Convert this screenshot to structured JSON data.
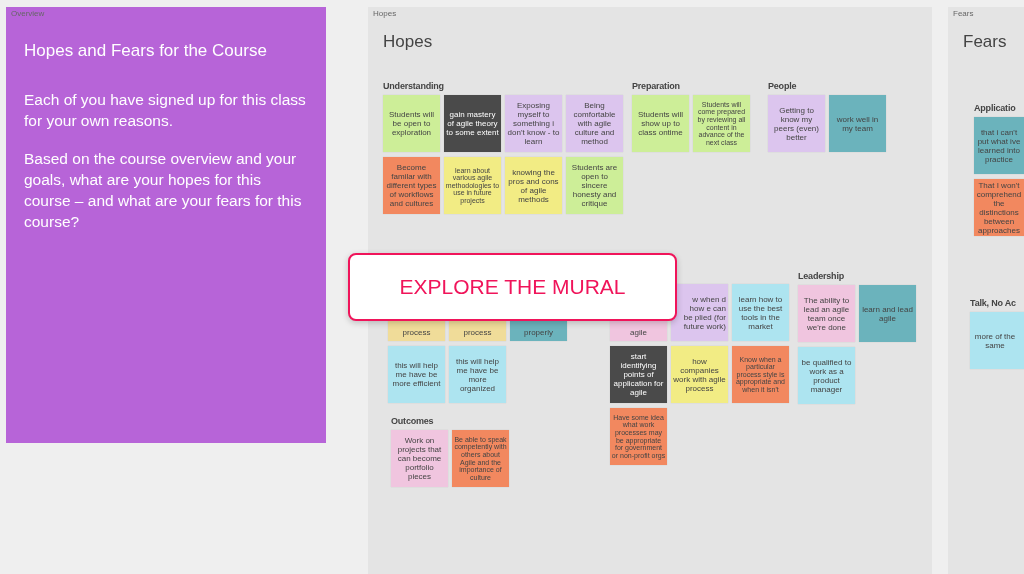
{
  "frames": [
    {
      "kind": "text-card",
      "label": "Overview",
      "title": "Hopes and Fears for the Course",
      "paragraphs": [
        "Each of you have signed up for this class for your own reasons.",
        "Based on the course overview and your goals, what are your hopes for this course – and what are your fears for this course?"
      ]
    },
    {
      "kind": "board",
      "label": "Hopes",
      "title": "Hopes",
      "groups": [
        {
          "title": "Understanding",
          "rows": [
            [
              {
                "text": "Students will be open to exploration",
                "color": "#cdee98"
              },
              {
                "text": "gain mastery of agile theory to some extent",
                "color": "#4a4a4a"
              },
              {
                "text": "Exposing myself to something i don't know - to learn",
                "color": "#dcc5ee"
              },
              {
                "text": "Being comfortable with agile culture and method",
                "color": "#dcc5ee"
              }
            ],
            [
              {
                "text": "Become familar with different types of workflows and cultures",
                "color": "#f2885f"
              },
              {
                "text": "learn about various agile methodologies to use in future projects",
                "color": "#f2ec84"
              },
              {
                "text": "knowing the pros and cons of agile methods",
                "color": "#f2ec84"
              },
              {
                "text": "Students are open to sincere honesty and critique",
                "color": "#cdee98"
              }
            ]
          ]
        },
        {
          "title": "Preparation",
          "rows": [
            [
              {
                "text": "Students will show up to class ontime",
                "color": "#cdee98"
              },
              {
                "text": "Students will come prepared by reviewing all content in advance of the next class",
                "color": "#cdee98"
              }
            ]
          ]
        },
        {
          "title": "People",
          "rows": [
            [
              {
                "text": "Getting to know my peers (even) better",
                "color": "#dcc5ee"
              },
              {
                "text": "work well in my team",
                "color": "#6bb3bc"
              }
            ]
          ]
        },
        {
          "rows": [
            [
              {
                "text": "process",
                "color": "#f0dc99",
                "kind": "partial-top"
              },
              {
                "text": "process",
                "color": "#f0dc99",
                "kind": "partial-top"
              },
              {
                "text": "properly",
                "color": "#6bb3bc",
                "kind": "partial-top"
              }
            ],
            [
              {
                "text": "this will help me have be more efficient",
                "color": "#ade4f0"
              },
              {
                "text": "this will help me have be more organized",
                "color": "#ade4f0"
              }
            ]
          ]
        },
        {
          "rows": [
            [
              {
                "text": "agile",
                "color": "#f0c5df",
                "kind": "partial-top"
              },
              {
                "text": "w when d how e can be plied (for future work)",
                "color": "#dcc5ee",
                "kind": "partial-left"
              },
              {
                "text": "learn how to use the best tools in the market",
                "color": "#ade4f0"
              }
            ],
            [
              {
                "text": "start identifying points of application for agile",
                "color": "#4a4a4a"
              },
              {
                "text": "how companies work with agile process",
                "color": "#f2ec84"
              },
              {
                "text": "Know when a particular process style is appropriate and when it isn't",
                "color": "#f2885f"
              }
            ],
            [
              {
                "text": "Have some idea what work processes may be appropriate for government or non-profit orgs",
                "color": "#f2885f"
              }
            ]
          ]
        },
        {
          "title": "Leadership",
          "rows": [
            [
              {
                "text": "The ability to lead an agile team once we're done",
                "color": "#f0c5df"
              },
              {
                "text": "learn and lead agile",
                "color": "#6bb3bc"
              }
            ],
            [
              {
                "text": "be qualified to work as a product manager",
                "color": "#ade4f0"
              }
            ]
          ]
        },
        {
          "title": "Outcomes",
          "rows": [
            [
              {
                "text": "Work on projects that can become portfolio pieces",
                "color": "#f0c5df"
              },
              {
                "text": "Be able to speak competently with others about Agile and the importance of culture",
                "color": "#f2885f"
              }
            ]
          ]
        }
      ]
    },
    {
      "kind": "board",
      "label": "Fears",
      "title": "Fears",
      "groups": [
        {
          "title": "Applicatio",
          "rows": [
            [
              {
                "text": "that i can't put what ive learned into practice",
                "color": "#6bb3bc"
              }
            ],
            [
              {
                "text": "That I won't comprehend the distinctions between approaches",
                "color": "#f2885f"
              }
            ]
          ]
        },
        {
          "title": "Talk, No Ac",
          "rows": [
            [
              {
                "text": "more of the same",
                "color": "#ade4f0"
              }
            ]
          ]
        }
      ]
    }
  ],
  "overlay_button": {
    "label": "EXPLORE THE MURAL"
  }
}
